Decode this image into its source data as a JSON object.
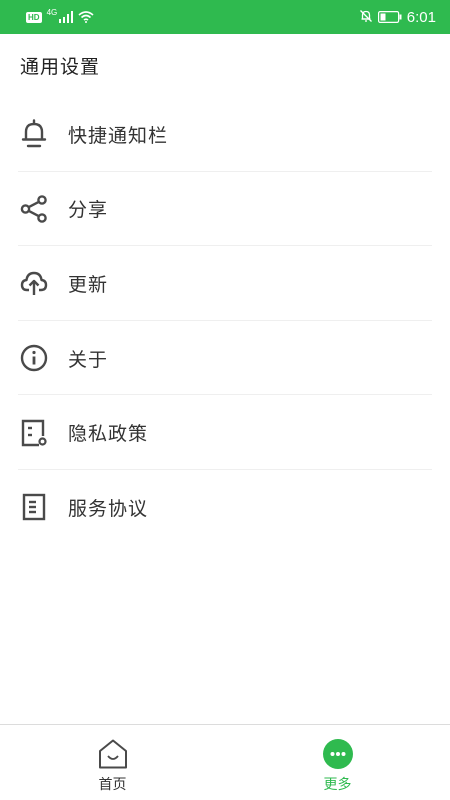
{
  "status_bar": {
    "hd": "HD",
    "network": "4G",
    "time": "6:01"
  },
  "page_title": "通用设置",
  "menu": [
    {
      "label": "快捷通知栏",
      "icon": "bell-icon"
    },
    {
      "label": "分享",
      "icon": "share-icon"
    },
    {
      "label": "更新",
      "icon": "cloud-upload-icon"
    },
    {
      "label": "关于",
      "icon": "info-icon"
    },
    {
      "label": "隐私政策",
      "icon": "privacy-doc-icon"
    },
    {
      "label": "服务协议",
      "icon": "agreement-doc-icon"
    }
  ],
  "bottom_nav": {
    "home_label": "首页",
    "more_label": "更多"
  },
  "colors": {
    "accent": "#2fba4f",
    "icon": "#4a4a4a",
    "text": "#333333"
  }
}
